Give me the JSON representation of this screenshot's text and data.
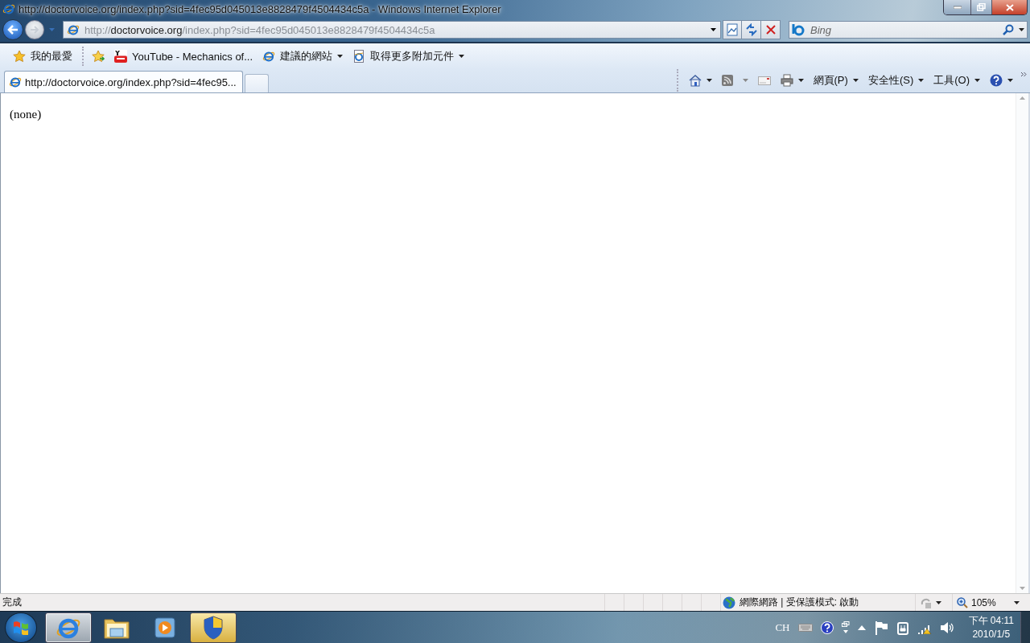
{
  "window": {
    "title": "http://doctorvoice.org/index.php?sid=4fec95d045013e8828479f4504434c5a - Windows Internet Explorer"
  },
  "address_bar": {
    "scheme": "http://",
    "host": "doctorvoice.org",
    "rest": "/index.php?sid=4fec95d045013e8828479f4504434c5a"
  },
  "search": {
    "placeholder": "Bing"
  },
  "favorites_bar": [
    {
      "kind": "favorites",
      "label": "我的最愛",
      "dropdown": false
    },
    {
      "kind": "video",
      "label": "YouTube - Mechanics of...",
      "dropdown": false
    },
    {
      "kind": "suggested",
      "label": "建議的網站",
      "dropdown": true
    },
    {
      "kind": "addons",
      "label": "取得更多附加元件",
      "dropdown": true
    }
  ],
  "tabs": [
    {
      "label": "http://doctorvoice.org/index.php?sid=4fec95...",
      "selected": true
    }
  ],
  "command_bar": [
    {
      "kind": "home"
    },
    {
      "kind": "feeds"
    },
    {
      "kind": "mail"
    },
    {
      "kind": "print"
    },
    {
      "kind": "menu",
      "label": "網頁(P)"
    },
    {
      "kind": "menu",
      "label": "安全性(S)"
    },
    {
      "kind": "menu",
      "label": "工具(O)"
    },
    {
      "kind": "help"
    }
  ],
  "content": {
    "text": "(none)"
  },
  "status_bar": {
    "text": "完成",
    "zone": "網際網路 | 受保護模式: 啟動",
    "zoom": "105%"
  },
  "taskbar": {
    "apps": [
      {
        "kind": "ie",
        "selected": true,
        "highlighted": false
      },
      {
        "kind": "explorer",
        "selected": false,
        "highlighted": false
      },
      {
        "kind": "media",
        "selected": false,
        "highlighted": false
      },
      {
        "kind": "security",
        "selected": false,
        "highlighted": true
      }
    ],
    "language": "CH",
    "time": "下午 04:11",
    "date": "2010/1/5"
  }
}
